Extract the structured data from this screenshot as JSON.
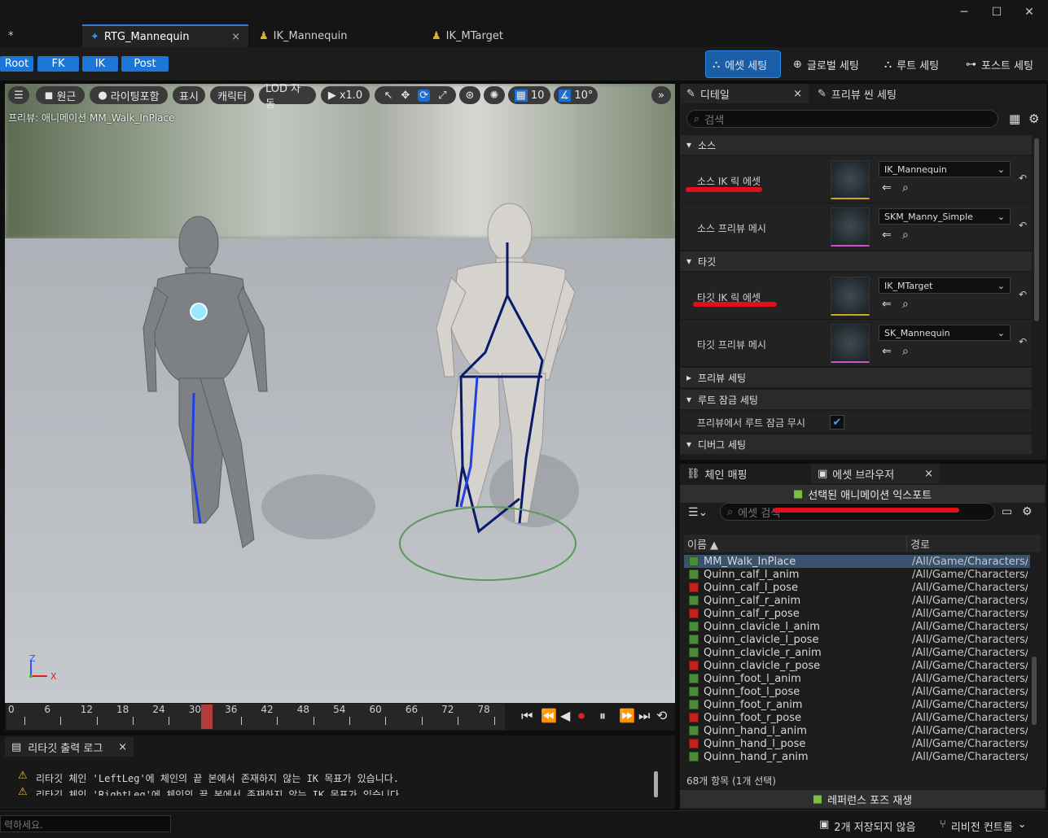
{
  "window": {
    "minimize": "─",
    "maximize": "☐",
    "close": "✕"
  },
  "tabs": [
    {
      "label": "*"
    },
    {
      "label": "RTG_Mannequin",
      "close": "×"
    },
    {
      "label": "IK_Mannequin"
    },
    {
      "label": "IK_MTarget"
    }
  ],
  "mode_buttons": [
    "Root",
    "FK",
    "IK",
    "Post"
  ],
  "right_tools": [
    "에셋 세팅",
    "글로벌 세팅",
    "루트 세팅",
    "포스트 세팅"
  ],
  "viewport": {
    "toolbar": {
      "menu": "☰",
      "perspective": "원근",
      "lighting": "라이팅포함",
      "show": "표시",
      "character": "캐릭터",
      "lod": "LOD 자동",
      "play_speed": "x1.0",
      "grid_value": "10",
      "angle_value": "10°",
      "more": "»"
    },
    "preview_label": "프리뷰: 애니메이션 MM_Walk_InPlace",
    "axis": {
      "z": "Z",
      "x": "X"
    }
  },
  "timeline": {
    "ticks": [
      "0",
      "6",
      "12",
      "18",
      "24",
      "30",
      "36",
      "42",
      "48",
      "54",
      "60",
      "66",
      "72",
      "78"
    ],
    "current_frame": 32
  },
  "log": {
    "tab_label": "리타깃 출력 로그",
    "close": "×",
    "lines": [
      "리타깃 체인 'LeftLeg'에 체인의 끝 본에서 존재하지 않는 IK 목표가 있습니다.",
      "리타깃 체인 'RightLeg'에 체인의 끝 본에서 존재하지 않는 IK 목표가 있습니다."
    ]
  },
  "command_placeholder": "력하세요.",
  "details": {
    "tab_label": "디테일",
    "tab_close": "×",
    "scene_tab_label": "프리뷰 씬 세팅",
    "search_placeholder": "검색",
    "sections": {
      "source": "소스",
      "target": "타깃",
      "preview": "프리뷰 세팅",
      "root_lock": "루트 잠금 세팅",
      "debug": "디버그 세팅"
    },
    "rows": {
      "source_ik": {
        "label": "소스 IK 릭 에셋",
        "value": "IK_Mannequin"
      },
      "source_mesh": {
        "label": "소스 프리뷰 메시",
        "value": "SKM_Manny_Simple"
      },
      "target_ik": {
        "label": "타깃 IK 릭 에셋",
        "value": "IK_MTarget"
      },
      "target_mesh": {
        "label": "타깃 프리뷰 메시",
        "value": "SK_Mannequin"
      },
      "ignore_root_lock": {
        "label": "프리뷰에서 루트 잠금 무시",
        "checked": true
      }
    }
  },
  "browser": {
    "chain_tab": "체인 매핑",
    "asset_tab": "에셋 브라우저",
    "asset_close": "×",
    "export_label": "선택된 애니메이션 익스포트",
    "search_placeholder": "에셋 검색",
    "col_name": "이름 ▲",
    "col_path": "경로",
    "items": [
      {
        "name": "MM_Walk_InPlace",
        "path": "/All/Game/Characters/N",
        "type": "anim",
        "selected": true
      },
      {
        "name": "Quinn_calf_l_anim",
        "path": "/All/Game/Characters/N",
        "type": "anim"
      },
      {
        "name": "Quinn_calf_l_pose",
        "path": "/All/Game/Characters/N",
        "type": "pose"
      },
      {
        "name": "Quinn_calf_r_anim",
        "path": "/All/Game/Characters/N",
        "type": "anim"
      },
      {
        "name": "Quinn_calf_r_pose",
        "path": "/All/Game/Characters/N",
        "type": "pose"
      },
      {
        "name": "Quinn_clavicle_l_anim",
        "path": "/All/Game/Characters/N",
        "type": "anim"
      },
      {
        "name": "Quinn_clavicle_l_pose",
        "path": "/All/Game/Characters/N",
        "type": "anim"
      },
      {
        "name": "Quinn_clavicle_r_anim",
        "path": "/All/Game/Characters/N",
        "type": "anim"
      },
      {
        "name": "Quinn_clavicle_r_pose",
        "path": "/All/Game/Characters/N",
        "type": "pose"
      },
      {
        "name": "Quinn_foot_l_anim",
        "path": "/All/Game/Characters/N",
        "type": "anim"
      },
      {
        "name": "Quinn_foot_l_pose",
        "path": "/All/Game/Characters/N",
        "type": "anim"
      },
      {
        "name": "Quinn_foot_r_anim",
        "path": "/All/Game/Characters/N",
        "type": "anim"
      },
      {
        "name": "Quinn_foot_r_pose",
        "path": "/All/Game/Characters/N",
        "type": "pose"
      },
      {
        "name": "Quinn_hand_l_anim",
        "path": "/All/Game/Characters/N",
        "type": "anim"
      },
      {
        "name": "Quinn_hand_l_pose",
        "path": "/All/Game/Characters/N",
        "type": "pose"
      },
      {
        "name": "Quinn_hand_r_anim",
        "path": "/All/Game/Characters/N",
        "type": "anim"
      }
    ],
    "count_label": "68개 항목 (1개 선택)",
    "ref_pose_label": "레퍼런스 포즈 재생"
  },
  "status": {
    "unsaved": "2개 저장되지 않음",
    "revision": "리비전 컨트롤"
  },
  "colors": {
    "accent": "#1b76d8",
    "annotation_red": "#e0101a"
  }
}
